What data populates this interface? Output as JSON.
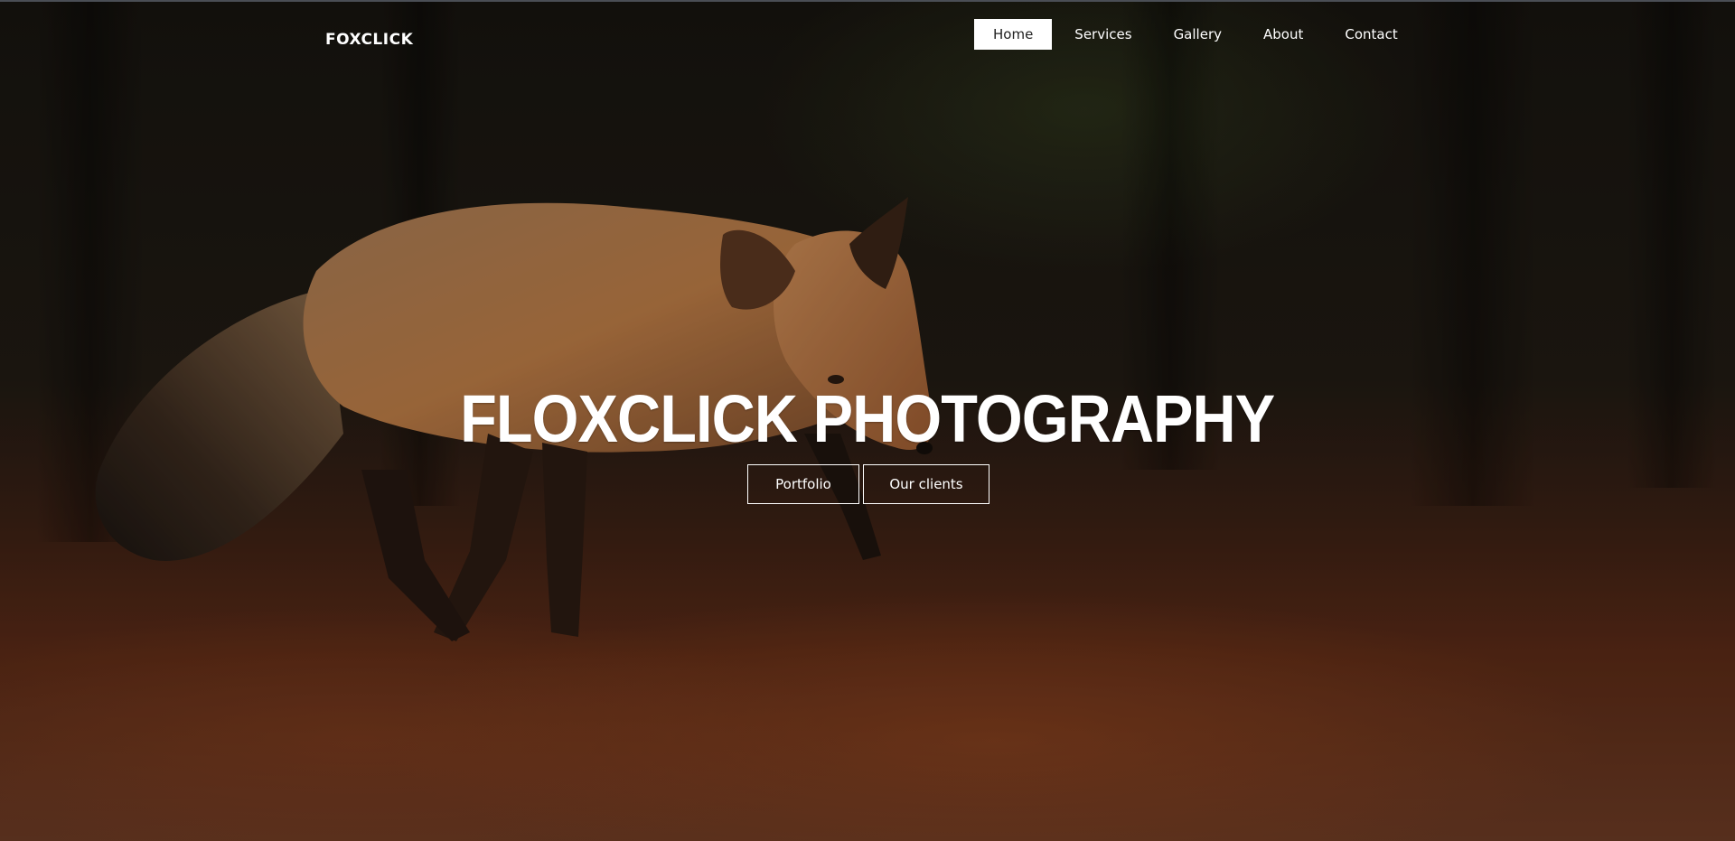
{
  "brand": {
    "name": "FOXCLICK"
  },
  "nav": {
    "items": [
      {
        "label": "Home",
        "active": true
      },
      {
        "label": "Services",
        "active": false
      },
      {
        "label": "Gallery",
        "active": false
      },
      {
        "label": "About",
        "active": false
      },
      {
        "label": "Contact",
        "active": false
      }
    ]
  },
  "hero": {
    "title": "FLOXCLICK PHOTOGRAPHY",
    "buttons": [
      {
        "label": "Portfolio"
      },
      {
        "label": "Our clients"
      }
    ]
  },
  "colors": {
    "nav_active_bg": "#ffffff",
    "nav_active_text": "#222222",
    "text": "#ffffff"
  }
}
